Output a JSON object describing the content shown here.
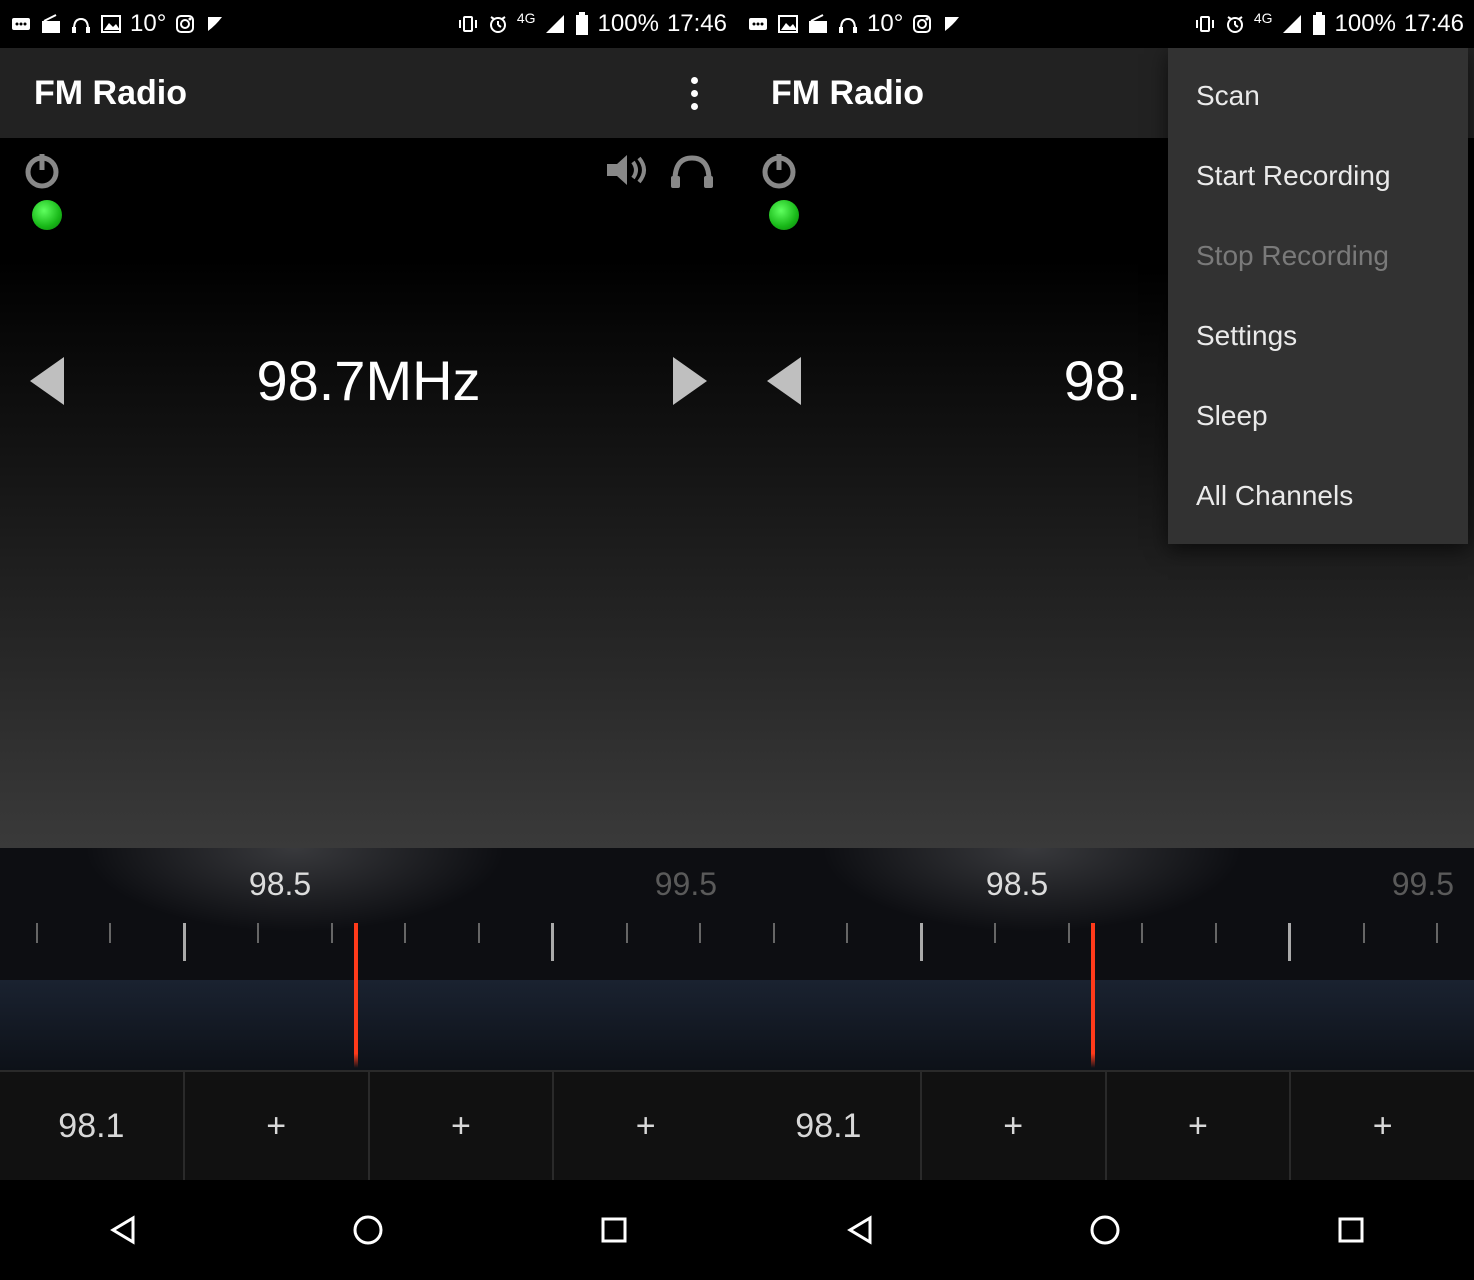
{
  "statusbar": {
    "temp": "10°",
    "network": "4G",
    "battery": "100%",
    "time": "17:46"
  },
  "app": {
    "title": "FM Radio"
  },
  "frequency": {
    "display_left": "98.7MHz",
    "display_right": "98."
  },
  "dial": {
    "center_label": "98.5",
    "right_label": "99.5"
  },
  "presets": {
    "p1": "98.1",
    "p2": "+",
    "p3": "+",
    "p4": "+"
  },
  "menu": {
    "scan": "Scan",
    "start_rec": "Start Recording",
    "stop_rec": "Stop Recording",
    "settings": "Settings",
    "sleep": "Sleep",
    "all_channels": "All Channels"
  }
}
